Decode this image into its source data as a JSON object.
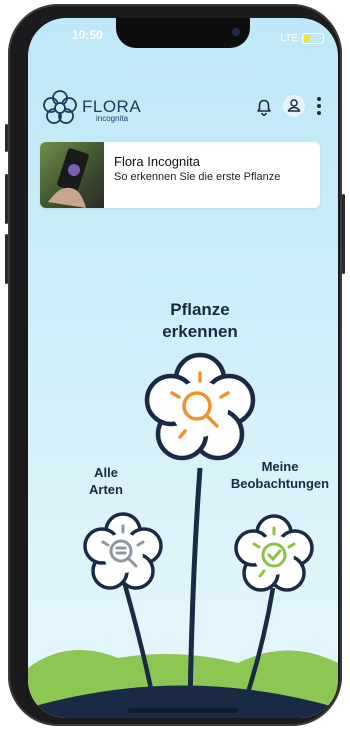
{
  "status_bar": {
    "time": "10:50",
    "network": "LTE"
  },
  "header": {
    "logo_text": "FLORA",
    "logo_subtext": "incognita",
    "icons": [
      "bell-icon",
      "profile-icon",
      "more-vertical-icon"
    ]
  },
  "banner": {
    "title": "Flora Incognita",
    "subtitle": "So erkennen Sie die erste Pflanze"
  },
  "actions": {
    "identify": {
      "line1": "Pflanze",
      "line2": "erkennen",
      "icon": "magnifier-icon"
    },
    "species": {
      "line1": "Alle",
      "line2": "Arten",
      "icon": "species-list-icon"
    },
    "observations": {
      "line1": "Meine",
      "line2": "Beobachtungen",
      "icon": "check-icon"
    }
  },
  "colors": {
    "sky": "#cdeef9",
    "navy": "#1b2a44",
    "orange": "#f0922b",
    "grey": "#8b97a3",
    "green": "#8cc24a"
  }
}
